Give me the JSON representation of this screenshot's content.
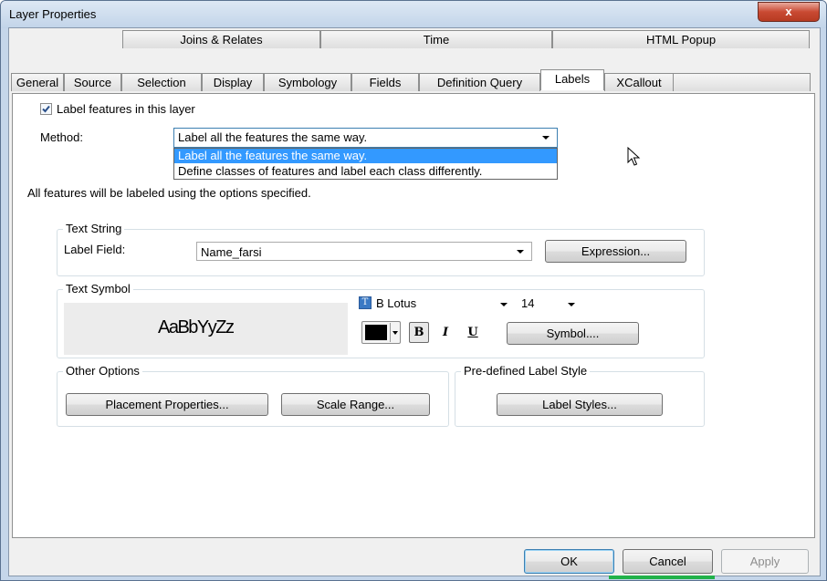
{
  "window": {
    "title": "Layer Properties",
    "close_label": "x"
  },
  "tabs": {
    "row_top": [
      {
        "name": "tab-joins-relates",
        "label": "Joins & Relates"
      },
      {
        "name": "tab-time",
        "label": "Time"
      },
      {
        "name": "tab-html-popup",
        "label": "HTML Popup"
      }
    ],
    "row_bottom": [
      {
        "name": "tab-general",
        "label": "General"
      },
      {
        "name": "tab-source",
        "label": "Source"
      },
      {
        "name": "tab-selection",
        "label": "Selection"
      },
      {
        "name": "tab-display",
        "label": "Display"
      },
      {
        "name": "tab-symbology",
        "label": "Symbology"
      },
      {
        "name": "tab-fields",
        "label": "Fields"
      },
      {
        "name": "tab-definition-query",
        "label": "Definition Query"
      },
      {
        "name": "tab-labels",
        "label": "Labels",
        "active": true
      },
      {
        "name": "tab-xcallout",
        "label": "XCallout"
      }
    ]
  },
  "labels_tab": {
    "label_features_checkbox": {
      "label": "Label features in this layer",
      "checked": true
    },
    "method": {
      "label": "Method:",
      "selected": "Label all the features the same way.",
      "options": [
        "Label all the features the same way.",
        "Define classes of features and label each class differently."
      ]
    },
    "info_text": "All features will be labeled using the options specified.",
    "text_string": {
      "group_label": "Text String",
      "label_field_label": "Label Field:",
      "label_field_value": "Name_farsi",
      "expression_button": "Expression..."
    },
    "text_symbol": {
      "group_label": "Text Symbol",
      "preview_text": "AaBbYyZz",
      "font_name": "B Lotus",
      "font_size": "14",
      "color": "#000000",
      "bold_label": "B",
      "italic_label": "I",
      "underline_label": "U",
      "symbol_button": "Symbol...."
    },
    "other_options": {
      "group_label": "Other Options",
      "placement_button": "Placement Properties...",
      "scale_range_button": "Scale Range..."
    },
    "predefined_style": {
      "group_label": "Pre-defined Label Style",
      "label_styles_button": "Label Styles..."
    }
  },
  "footer": {
    "ok": "OK",
    "cancel": "Cancel",
    "apply": "Apply"
  },
  "colors": {
    "dropdown_highlight": "#3399ff",
    "accent_focus": "#3c7fb1",
    "title_bar": "#c2d4e9",
    "close_button": "#c94a33"
  }
}
